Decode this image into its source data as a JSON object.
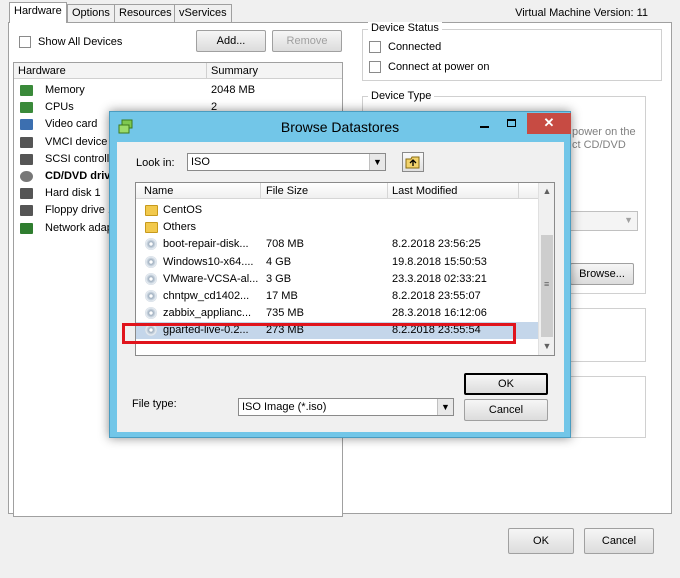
{
  "main": {
    "tabs": [
      "Hardware",
      "Options",
      "Resources",
      "vServices"
    ],
    "vm_version": "Virtual Machine Version: 11",
    "show_all_devices": "Show All Devices",
    "add_button": "Add...",
    "remove_button": "Remove",
    "hw_table": {
      "headers": [
        "Hardware",
        "Summary"
      ],
      "rows": [
        {
          "name": "Memory",
          "summary": "2048 MB",
          "icon": "memory-icon"
        },
        {
          "name": "CPUs",
          "summary": "2",
          "icon": "cpu-icon"
        },
        {
          "name": "Video card",
          "summary": "",
          "icon": "monitor-icon"
        },
        {
          "name": "VMCI device",
          "summary": "",
          "icon": "device-icon"
        },
        {
          "name": "SCSI controlle",
          "summary": "",
          "icon": "scsi-icon"
        },
        {
          "name": "CD/DVD driv",
          "summary": "",
          "icon": "cd-icon"
        },
        {
          "name": "Hard disk 1",
          "summary": "",
          "icon": "disk-icon"
        },
        {
          "name": "Floppy drive 1",
          "summary": "",
          "icon": "floppy-icon"
        },
        {
          "name": "Network adap",
          "summary": "",
          "icon": "network-icon"
        }
      ]
    },
    "device_status": {
      "title": "Device Status",
      "connected": "Connected",
      "connect_at_power_on": "Connect at power on"
    },
    "device_type": {
      "title": "Device Type",
      "side_text_1": "power on the",
      "side_text_2": "ct CD/DVD"
    },
    "browse_button": "Browse...",
    "ok_button": "OK",
    "cancel_button": "Cancel"
  },
  "dialog": {
    "title": "Browse Datastores",
    "look_in_label": "Look in:",
    "look_in_value": "ISO",
    "headers": [
      "Name",
      "File Size",
      "Last Modified"
    ],
    "files": [
      {
        "name": "CentOS",
        "size": "",
        "modified": "",
        "type": "folder"
      },
      {
        "name": "Others",
        "size": "",
        "modified": "",
        "type": "folder"
      },
      {
        "name": "boot-repair-disk...",
        "size": "708 MB",
        "modified": "8.2.2018 23:56:25",
        "type": "iso"
      },
      {
        "name": "Windows10-x64....",
        "size": "4 GB",
        "modified": "19.8.2018 15:50:53",
        "type": "iso"
      },
      {
        "name": "VMware-VCSA-al...",
        "size": "3 GB",
        "modified": "23.3.2018 02:33:21",
        "type": "iso"
      },
      {
        "name": "chntpw_cd1402...",
        "size": "17 MB",
        "modified": "8.2.2018 23:55:07",
        "type": "iso"
      },
      {
        "name": "zabbix_applianc...",
        "size": "735 MB",
        "modified": "28.3.2018 16:12:06",
        "type": "iso"
      },
      {
        "name": "gparted-live-0.2...",
        "size": "273 MB",
        "modified": "8.2.2018 23:55:54",
        "type": "iso"
      }
    ],
    "selected_index": 7,
    "file_type_label": "File type:",
    "file_type_value": "ISO Image (*.iso)",
    "ok_button": "OK",
    "cancel_button": "Cancel"
  }
}
